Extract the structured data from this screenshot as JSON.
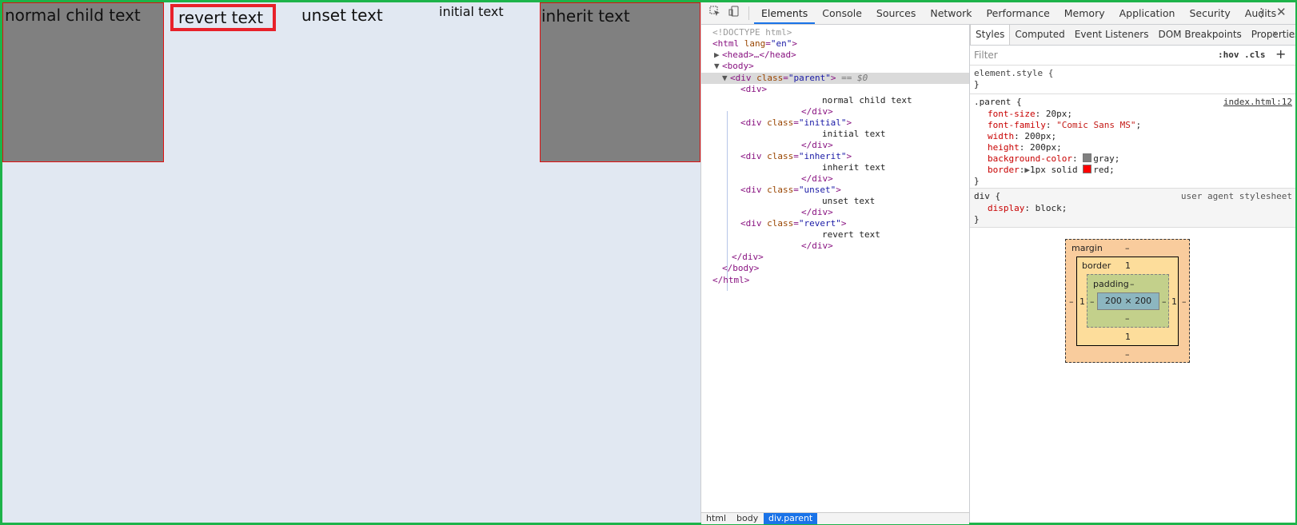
{
  "page": {
    "normal_text": "normal child text",
    "revert_text": "revert text",
    "unset_text": "unset text",
    "initial_text": "initial text",
    "inherit_text": "inherit text"
  },
  "devtools": {
    "tabs": [
      "Elements",
      "Console",
      "Sources",
      "Network",
      "Performance",
      "Memory",
      "Application",
      "Security",
      "Audits"
    ],
    "active_tab": "Elements",
    "dom": {
      "doctype": "<!DOCTYPE html>",
      "html_open_tag": "<html",
      "html_attr": "lang",
      "html_val": "\"en\"",
      "head": "<head>…</head>",
      "body_open": "<body>",
      "parent_tag": "<div",
      "parent_attr": "class",
      "parent_val": "\"parent\"",
      "selected_marker": "== $0",
      "child_div_open": "<div>",
      "normal_text": "normal child text",
      "initial_val": "\"initial\"",
      "initial_text": "initial text",
      "inherit_val": "\"inherit\"",
      "inherit_text": "inherit text",
      "unset_val": "\"unset\"",
      "unset_text": "unset text",
      "revert_val": "\"revert\"",
      "revert_text": "revert text",
      "div_close": "</div>",
      "body_close": "</body>",
      "html_close": "</html>",
      "ellipsis": "…"
    },
    "breadcrumb": [
      "html",
      "body",
      "div.parent"
    ],
    "styles_tabs": [
      "Styles",
      "Computed",
      "Event Listeners",
      "DOM Breakpoints",
      "Properties"
    ],
    "filter_placeholder": "Filter",
    "hov": ":hov",
    "cls": ".cls",
    "rules": {
      "element_style": "element.style {",
      "parent_selector": ".parent {",
      "parent_source": "index.html:12",
      "font_size_name": "font-size",
      "font_size_val": "20px;",
      "font_family_name": "font-family",
      "font_family_val": "\"Comic Sans MS\"",
      "width_name": "width",
      "width_val": "200px;",
      "height_name": "height",
      "height_val": "200px;",
      "bg_name": "background-color",
      "bg_val": "gray;",
      "border_name": "border",
      "border_val": "1px solid",
      "border_color": "red;",
      "div_selector": "div {",
      "div_source": "user agent stylesheet",
      "display_name": "display",
      "display_val": "block;",
      "close_brace": "}"
    },
    "box_model": {
      "margin_label": "margin",
      "margin_value": "–",
      "border_label": "border",
      "border_value": "1",
      "padding_label": "padding",
      "padding_value": "–",
      "content": "200 × 200",
      "left_border": "1",
      "right_border": "1",
      "bottom_border": "1",
      "dash": "–"
    }
  },
  "colors": {
    "frame": "#1db34a",
    "page_bg": "#e1e8f2",
    "box_gray": "#808080",
    "box_border": "#e01010",
    "highlight_red": "#e8212a"
  }
}
